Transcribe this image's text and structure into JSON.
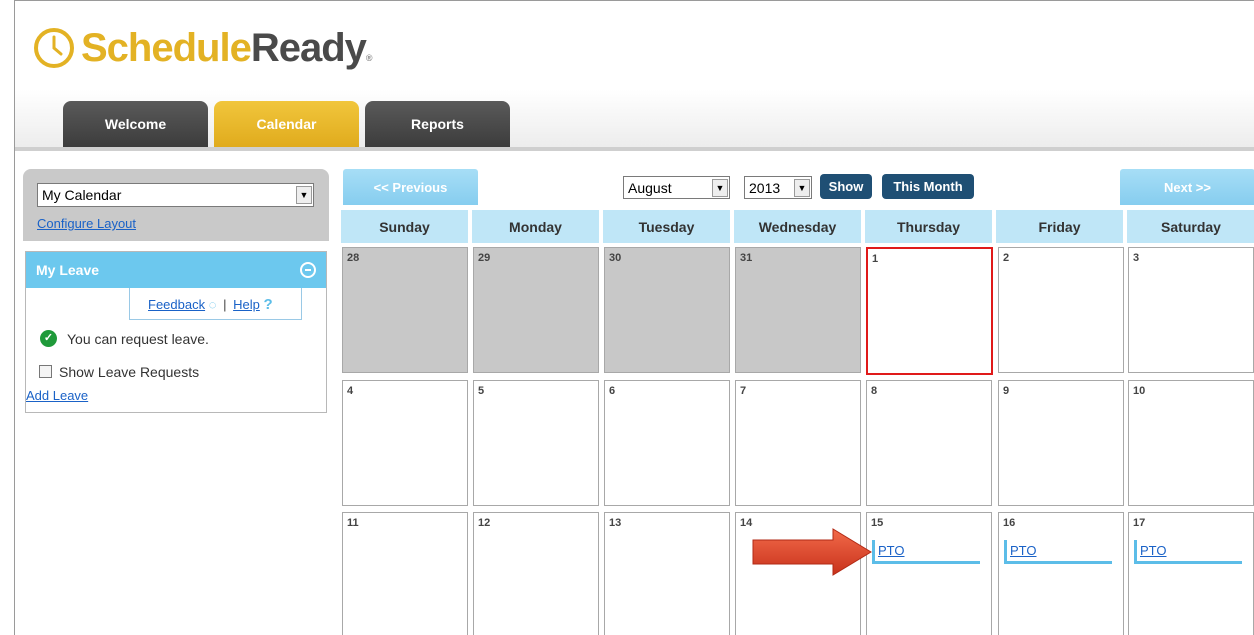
{
  "app": {
    "logo_part1": "Schedule",
    "logo_part2": "Ready",
    "logo_mark": "®"
  },
  "tabs": [
    {
      "label": "Welcome",
      "active": false
    },
    {
      "label": "Calendar",
      "active": true
    },
    {
      "label": "Reports",
      "active": false
    }
  ],
  "sidebar": {
    "calendar_select": "My Calendar",
    "configure_layout": "Configure Layout",
    "leave_panel": {
      "title": "My Leave",
      "feedback": "Feedback",
      "separator": "|",
      "help": "Help",
      "status": "You can request leave.",
      "show_requests": "Show Leave Requests",
      "add_leave": "Add Leave"
    }
  },
  "calendar": {
    "previous": "<< Previous",
    "next": "Next >>",
    "month": "August",
    "year": "2013",
    "show": "Show",
    "this_month": "This Month",
    "days": [
      "Sunday",
      "Monday",
      "Tuesday",
      "Wednesday",
      "Thursday",
      "Friday",
      "Saturday"
    ],
    "weeks": [
      [
        {
          "day": "28",
          "other_month": true
        },
        {
          "day": "29",
          "other_month": true
        },
        {
          "day": "30",
          "other_month": true
        },
        {
          "day": "31",
          "other_month": true
        },
        {
          "day": "1",
          "today": true
        },
        {
          "day": "2"
        },
        {
          "day": "3"
        }
      ],
      [
        {
          "day": "4"
        },
        {
          "day": "5"
        },
        {
          "day": "6"
        },
        {
          "day": "7"
        },
        {
          "day": "8"
        },
        {
          "day": "9"
        },
        {
          "day": "10"
        }
      ],
      [
        {
          "day": "11"
        },
        {
          "day": "12"
        },
        {
          "day": "13"
        },
        {
          "day": "14"
        },
        {
          "day": "15",
          "event": "PTO"
        },
        {
          "day": "16",
          "event": "PTO"
        },
        {
          "day": "17",
          "event": "PTO"
        }
      ]
    ]
  },
  "colors": {
    "accent_yellow": "#e3b224",
    "header_blue": "#6cc8ee",
    "today_border": "#e01a1a",
    "dark_button": "#1f4f74"
  }
}
